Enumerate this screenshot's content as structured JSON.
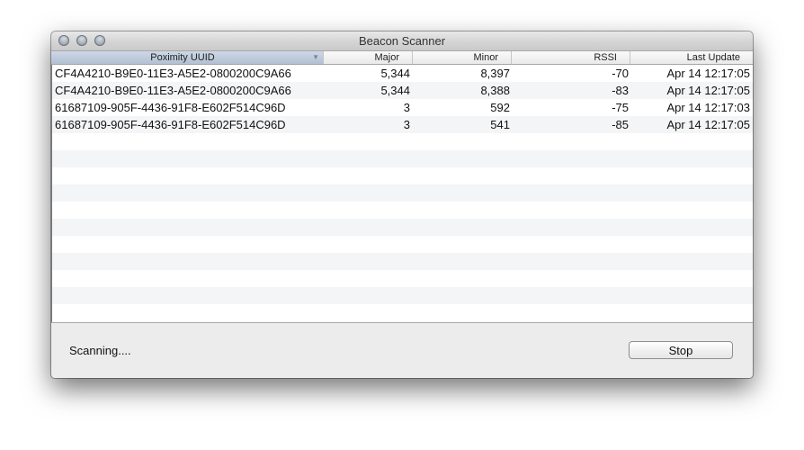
{
  "window": {
    "title": "Beacon Scanner",
    "controls": [
      "close",
      "minimize",
      "zoom"
    ]
  },
  "table": {
    "columns": [
      {
        "label": "Poximity UUID",
        "sorted": true,
        "sort_icon": "chevron-down-icon"
      },
      {
        "label": "Major"
      },
      {
        "label": "Minor"
      },
      {
        "label": "RSSI"
      },
      {
        "label": "Last Update"
      }
    ],
    "rows": [
      {
        "uuid": "CF4A4210-B9E0-11E3-A5E2-0800200C9A66",
        "major": "5,344",
        "minor": "8,397",
        "rssi": "-70",
        "last_update": "Apr 14 12:17:05"
      },
      {
        "uuid": "CF4A4210-B9E0-11E3-A5E2-0800200C9A66",
        "major": "5,344",
        "minor": "8,388",
        "rssi": "-83",
        "last_update": "Apr 14 12:17:05"
      },
      {
        "uuid": "61687109-905F-4436-91F8-E602F514C96D",
        "major": "3",
        "minor": "592",
        "rssi": "-75",
        "last_update": "Apr 14 12:17:03"
      },
      {
        "uuid": "61687109-905F-4436-91F8-E602F514C96D",
        "major": "3",
        "minor": "541",
        "rssi": "-85",
        "last_update": "Apr 14 12:17:05"
      }
    ]
  },
  "footer": {
    "status": "Scanning....",
    "stop_label": "Stop"
  }
}
